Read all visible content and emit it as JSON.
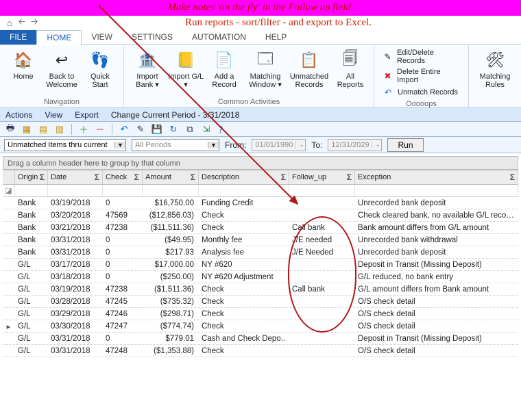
{
  "banner": {
    "line1": "Make notes 'on the fly' in the Follow up field.",
    "line2": "Run reports - sort/filter - and export to Excel."
  },
  "ribbon_tabs": [
    "FILE",
    "HOME",
    "VIEW",
    "SETTINGS",
    "AUTOMATION",
    "HELP"
  ],
  "ribbon": {
    "navigation": {
      "label": "Navigation",
      "home": "Home",
      "back": "Back to Welcome",
      "quick": "Quick Start"
    },
    "common": {
      "label": "Common Activities",
      "import_bank": "Import Bank",
      "import_gl": "Import G/L",
      "add": "Add a Record",
      "match_win": "Matching Window",
      "unmatched": "Unmatched Records",
      "reports": "All Reports"
    },
    "oops": {
      "label": "Ooooops",
      "edit": "Edit/Delete Records",
      "del": "Delete Entire Import",
      "unmatch": "Unmatch Records"
    },
    "rules": {
      "label": "",
      "rules": "Matching Rules"
    }
  },
  "subbar": {
    "actions": "Actions",
    "view": "View",
    "export": "Export",
    "period_label": "Change Current Period - ",
    "period": "3/31/2018"
  },
  "filter": {
    "scope": "Unmatched Items thru current",
    "periods": "All Periods",
    "from_label": "From:",
    "from": "01/01/1990",
    "to_label": "To:",
    "to": "12/31/2029",
    "run": "Run"
  },
  "groupbar": "Drag a column header here to group by that column",
  "columns": {
    "origin": "Origin",
    "date": "Date",
    "check": "Check",
    "amount": "Amount",
    "desc": "Description",
    "follow": "Follow_up",
    "except": "Exception"
  },
  "rows": [
    {
      "origin": "Bank",
      "date": "03/19/2018",
      "check": "0",
      "amount": "$16,750.00",
      "desc": "Funding Credit",
      "follow": "",
      "except": "Unrecorded bank deposit"
    },
    {
      "origin": "Bank",
      "date": "03/20/2018",
      "check": "47569",
      "amount": "($12,856.03)",
      "desc": "Check",
      "follow": "",
      "except": "Check cleared bank, no available G/L record.."
    },
    {
      "origin": "Bank",
      "date": "03/21/2018",
      "check": "47238",
      "amount": "($11,511.36)",
      "desc": "Check",
      "follow": "Call bank",
      "except": "Bank amount differs from G/L amount"
    },
    {
      "origin": "Bank",
      "date": "03/31/2018",
      "check": "0",
      "amount": "($49.95)",
      "desc": "Monthly fee",
      "follow": "J/E needed",
      "except": "Unrecorded bank withdrawal"
    },
    {
      "origin": "Bank",
      "date": "03/31/2018",
      "check": "0",
      "amount": "$217.93",
      "desc": "Analysis fee",
      "follow": "J/E Needed",
      "except": "Unrecorded bank deposit"
    },
    {
      "origin": "G/L",
      "date": "03/17/2018",
      "check": "0",
      "amount": "$17,000.00",
      "desc": "NY #620",
      "follow": "",
      "except": "Deposit in Transit (Missing Deposit)"
    },
    {
      "origin": "G/L",
      "date": "03/18/2018",
      "check": "0",
      "amount": "($250.00)",
      "desc": "NY #620 Adjustment",
      "follow": "",
      "except": "G/L reduced, no bank entry"
    },
    {
      "origin": "G/L",
      "date": "03/19/2018",
      "check": "47238",
      "amount": "($1,511.36)",
      "desc": "Check",
      "follow": "Call bank",
      "except": "G/L amount differs from Bank amount"
    },
    {
      "origin": "G/L",
      "date": "03/28/2018",
      "check": "47245",
      "amount": "($735.32)",
      "desc": "Check",
      "follow": "",
      "except": "O/S check detail"
    },
    {
      "origin": "G/L",
      "date": "03/29/2018",
      "check": "47246",
      "amount": "($298.71)",
      "desc": "Check",
      "follow": "",
      "except": "O/S check detail"
    },
    {
      "origin": "G/L",
      "date": "03/30/2018",
      "check": "47247",
      "amount": "($774.74)",
      "desc": "Check",
      "follow": "",
      "except": "O/S check detail",
      "marker": "▸"
    },
    {
      "origin": "G/L",
      "date": "03/31/2018",
      "check": "0",
      "amount": "$779.01",
      "desc": "Cash and Check Depo..",
      "follow": "",
      "except": "Deposit in Transit (Missing Deposit)"
    },
    {
      "origin": "G/L",
      "date": "03/31/2018",
      "check": "47248",
      "amount": "($1,353.88)",
      "desc": "Check",
      "follow": "",
      "except": "O/S check detail"
    }
  ]
}
